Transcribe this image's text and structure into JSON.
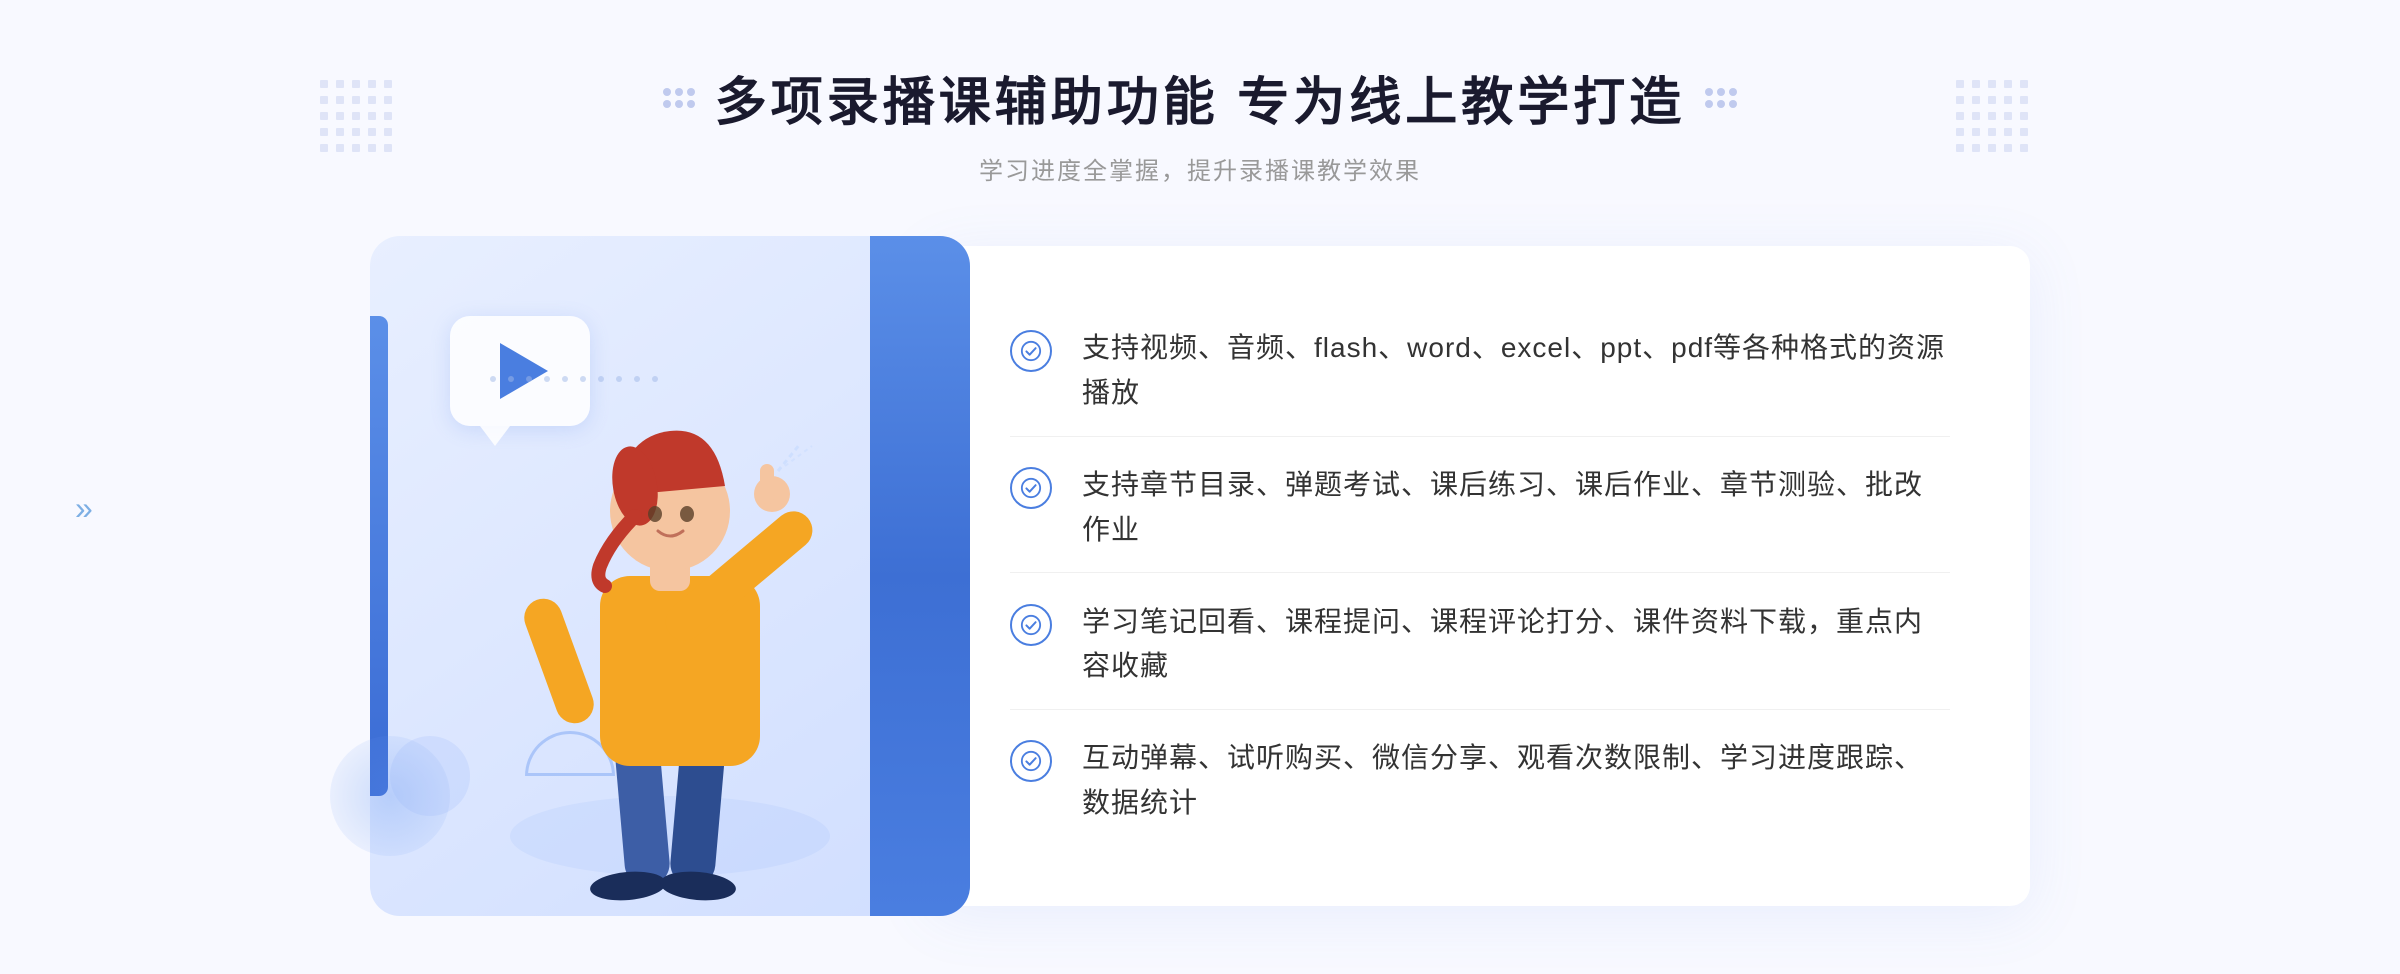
{
  "header": {
    "title": "多项录播课辅助功能 专为线上教学打造",
    "subtitle": "学习进度全掌握，提升录播课教学效果"
  },
  "features": [
    {
      "id": "feature-1",
      "text": "支持视频、音频、flash、word、excel、ppt、pdf等各种格式的资源播放"
    },
    {
      "id": "feature-2",
      "text": "支持章节目录、弹题考试、课后练习、课后作业、章节测验、批改作业"
    },
    {
      "id": "feature-3",
      "text": "学习笔记回看、课程提问、课程评论打分、课件资料下载，重点内容收藏"
    },
    {
      "id": "feature-4",
      "text": "互动弹幕、试听购买、微信分享、观看次数限制、学习进度跟踪、数据统计"
    }
  ],
  "decorators": {
    "left_decorator": "⁞⁞",
    "right_decorator": "⁞⁞"
  }
}
